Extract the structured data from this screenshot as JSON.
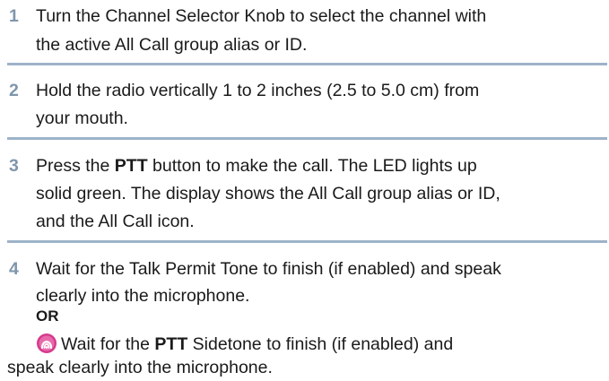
{
  "steps": [
    {
      "number": "1",
      "line1": "Turn the Channel Selector Knob to select the channel with",
      "line2": "the active All Call group alias or ID."
    },
    {
      "number": "2",
      "line1": "Hold the radio vertically 1 to 2 inches (2.5 to 5.0 cm) from",
      "line2": "your mouth."
    },
    {
      "number": "3",
      "line1_pre": "Press the ",
      "line1_bold": "PTT",
      "line1_post": " button to make the call. The LED lights up",
      "line2": "solid green. The display shows the All Call group alias or ID,",
      "line3": "and the All Call icon."
    },
    {
      "number": "4",
      "line1": "Wait for the Talk Permit Tone to finish (if enabled) and speak",
      "line2": "clearly into the microphone.",
      "or_label": "OR",
      "alt_pre": "Wait for the ",
      "alt_bold": "PTT",
      "alt_post": " Sidetone to finish (if enabled) and",
      "alt_line2": "speak clearly into the microphone.",
      "alt_icon": "ip-radio-icon"
    }
  ],
  "colors": {
    "step_number": "#7f96ac",
    "divider": "#9db3c9",
    "icon": "#d63a8c"
  }
}
